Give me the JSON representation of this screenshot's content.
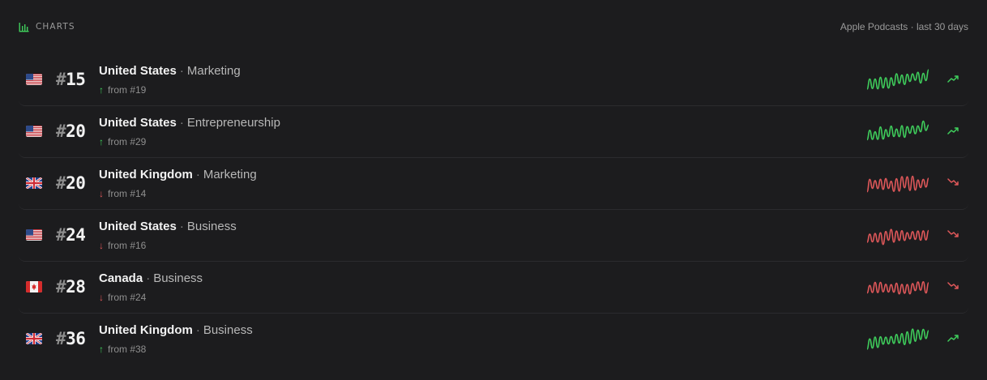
{
  "header": {
    "title": "CHARTS",
    "source": "Apple Podcasts · last 30 days"
  },
  "colors": {
    "up": "#3fce5c",
    "down": "#e0585a",
    "muted": "#9a9a9a"
  },
  "rankings": [
    {
      "flag": "us-flag-icon",
      "hash": "#",
      "rank": "15",
      "country": "United States",
      "sep": "·",
      "category": "Marketing",
      "direction": "up",
      "arrow": "↑",
      "change": "from #19"
    },
    {
      "flag": "us-flag-icon",
      "hash": "#",
      "rank": "20",
      "country": "United States",
      "sep": "·",
      "category": "Entrepreneurship",
      "direction": "up",
      "arrow": "↑",
      "change": "from #29"
    },
    {
      "flag": "uk-flag-icon",
      "hash": "#",
      "rank": "20",
      "country": "United Kingdom",
      "sep": "·",
      "category": "Marketing",
      "direction": "down",
      "arrow": "↓",
      "change": "from #14"
    },
    {
      "flag": "us-flag-icon",
      "hash": "#",
      "rank": "24",
      "country": "United States",
      "sep": "·",
      "category": "Business",
      "direction": "down",
      "arrow": "↓",
      "change": "from #16"
    },
    {
      "flag": "ca-flag-icon",
      "hash": "#",
      "rank": "28",
      "country": "Canada",
      "sep": "·",
      "category": "Business",
      "direction": "down",
      "arrow": "↓",
      "change": "from #24"
    },
    {
      "flag": "uk-flag-icon",
      "hash": "#",
      "rank": "36",
      "country": "United Kingdom",
      "sep": "·",
      "category": "Business",
      "direction": "up",
      "arrow": "↑",
      "change": "from #38"
    }
  ]
}
